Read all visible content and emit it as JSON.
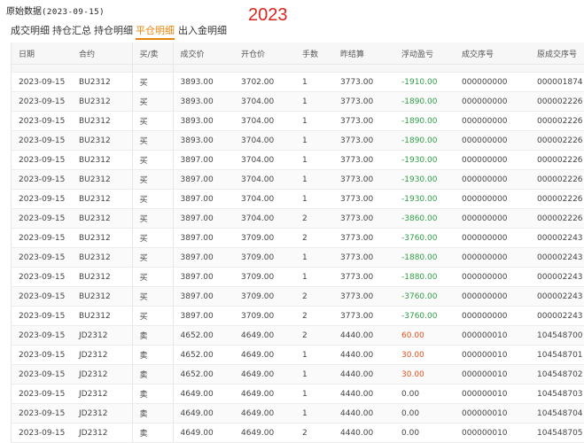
{
  "header": {
    "title": "原始数据",
    "date": "(2023-09-15)",
    "year": "2023"
  },
  "tabs": [
    {
      "label": "成交明细",
      "active": false
    },
    {
      "label": "持仓汇总",
      "active": false
    },
    {
      "label": "持仓明细",
      "active": false
    },
    {
      "label": "平仓明细",
      "active": true
    },
    {
      "label": "出入金明细",
      "active": false
    }
  ],
  "colors": {
    "accent": "#e6850e",
    "year": "#d9261c",
    "loss": "#2e9e45",
    "profit": "#e6501e"
  },
  "table": {
    "columns": [
      "日期",
      "合约",
      "买/卖",
      "成交价",
      "开仓价",
      "手数",
      "昨结算",
      "浮动盈亏",
      "成交序号",
      "原成交序号"
    ],
    "rows": [
      [
        "2023-09-15",
        "BU2312",
        "买",
        "3893.00",
        "3702.00",
        "1",
        "3773.00",
        "-1910.00",
        "000000000",
        "000001874"
      ],
      [
        "2023-09-15",
        "BU2312",
        "买",
        "3893.00",
        "3704.00",
        "1",
        "3773.00",
        "-1890.00",
        "000000000",
        "000002226"
      ],
      [
        "2023-09-15",
        "BU2312",
        "买",
        "3893.00",
        "3704.00",
        "1",
        "3773.00",
        "-1890.00",
        "000000000",
        "000002226"
      ],
      [
        "2023-09-15",
        "BU2312",
        "买",
        "3893.00",
        "3704.00",
        "1",
        "3773.00",
        "-1890.00",
        "000000000",
        "000002226"
      ],
      [
        "2023-09-15",
        "BU2312",
        "买",
        "3897.00",
        "3704.00",
        "1",
        "3773.00",
        "-1930.00",
        "000000000",
        "000002226"
      ],
      [
        "2023-09-15",
        "BU2312",
        "买",
        "3897.00",
        "3704.00",
        "1",
        "3773.00",
        "-1930.00",
        "000000000",
        "000002226"
      ],
      [
        "2023-09-15",
        "BU2312",
        "买",
        "3897.00",
        "3704.00",
        "1",
        "3773.00",
        "-1930.00",
        "000000000",
        "000002226"
      ],
      [
        "2023-09-15",
        "BU2312",
        "买",
        "3897.00",
        "3704.00",
        "2",
        "3773.00",
        "-3860.00",
        "000000000",
        "000002226"
      ],
      [
        "2023-09-15",
        "BU2312",
        "买",
        "3897.00",
        "3709.00",
        "2",
        "3773.00",
        "-3760.00",
        "000000000",
        "000002243"
      ],
      [
        "2023-09-15",
        "BU2312",
        "买",
        "3897.00",
        "3709.00",
        "1",
        "3773.00",
        "-1880.00",
        "000000000",
        "000002243"
      ],
      [
        "2023-09-15",
        "BU2312",
        "买",
        "3897.00",
        "3709.00",
        "1",
        "3773.00",
        "-1880.00",
        "000000000",
        "000002243"
      ],
      [
        "2023-09-15",
        "BU2312",
        "买",
        "3897.00",
        "3709.00",
        "2",
        "3773.00",
        "-3760.00",
        "000000000",
        "000002243"
      ],
      [
        "2023-09-15",
        "BU2312",
        "买",
        "3897.00",
        "3709.00",
        "2",
        "3773.00",
        "-3760.00",
        "000000000",
        "000002243"
      ],
      [
        "2023-09-15",
        "JD2312",
        "卖",
        "4652.00",
        "4649.00",
        "2",
        "4440.00",
        "60.00",
        "000000010",
        "104548700"
      ],
      [
        "2023-09-15",
        "JD2312",
        "卖",
        "4652.00",
        "4649.00",
        "1",
        "4440.00",
        "30.00",
        "000000010",
        "104548701"
      ],
      [
        "2023-09-15",
        "JD2312",
        "卖",
        "4652.00",
        "4649.00",
        "1",
        "4440.00",
        "30.00",
        "000000010",
        "104548702"
      ],
      [
        "2023-09-15",
        "JD2312",
        "卖",
        "4649.00",
        "4649.00",
        "1",
        "4440.00",
        "0.00",
        "000000010",
        "104548703"
      ],
      [
        "2023-09-15",
        "JD2312",
        "卖",
        "4649.00",
        "4649.00",
        "1",
        "4440.00",
        "0.00",
        "000000010",
        "104548704"
      ],
      [
        "2023-09-15",
        "JD2312",
        "卖",
        "4649.00",
        "4649.00",
        "2",
        "4440.00",
        "0.00",
        "000000010",
        "104548705"
      ]
    ]
  }
}
